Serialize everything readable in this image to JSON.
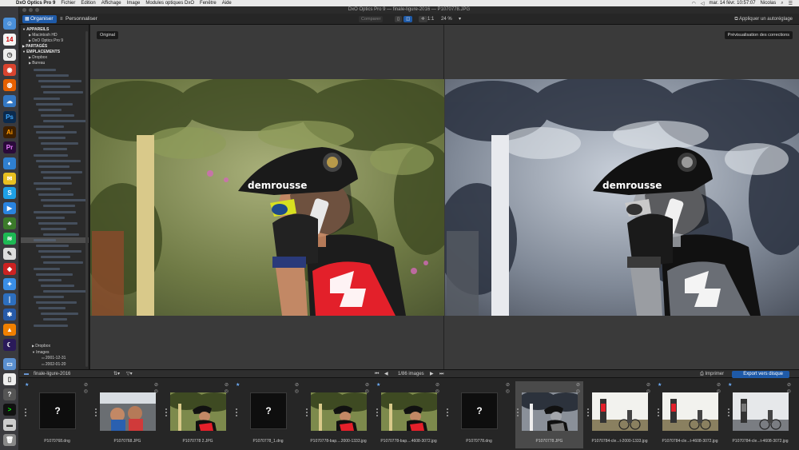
{
  "menubar": {
    "app": "DxO Optics Pro 9",
    "items": [
      "Fichier",
      "Edition",
      "Affichage",
      "Image",
      "Modules optiques DxO",
      "Fenêtre",
      "Aide"
    ],
    "clock": "mar. 14 févr. 10:57:07",
    "user": "Nicolas"
  },
  "window": {
    "app_title": "DxO Optics Pro 9",
    "title": "DxO Optics Pro 9 — finale-ligure-2016 — P1070778.JPG"
  },
  "toolbar": {
    "tab_organize": "Organiser",
    "tab_customize": "Personnaliser",
    "compare_label": "Comparer",
    "zoom_one": "1:1",
    "zoom_pct": "24 %",
    "apply_preset": "Appliquer un autoréglage"
  },
  "sidebar": {
    "rows": [
      {
        "text": "APPAREILS",
        "head": true,
        "indent": 2,
        "arrow": "▼"
      },
      {
        "text": "Macintosh HD",
        "indent": 10,
        "arrow": "▶"
      },
      {
        "text": "DxO Optics Pro 9",
        "indent": 10,
        "arrow": "▶"
      },
      {
        "text": "PARTAGÉS",
        "head": true,
        "indent": 2,
        "arrow": "▶"
      },
      {
        "text": "EMPLACEMENTS",
        "head": true,
        "indent": 2,
        "arrow": "▼"
      },
      {
        "text": "Dropbox",
        "indent": 10,
        "arrow": "▶"
      },
      {
        "text": "Bureau",
        "indent": 10,
        "arrow": "▶"
      }
    ],
    "bottom_rows": [
      {
        "text": "Dropbox",
        "indent": 14,
        "arrow": "▶"
      },
      {
        "text": "Images",
        "indent": 14,
        "arrow": "▼"
      },
      {
        "text": "2001-12-31",
        "indent": 26,
        "arrow": ""
      },
      {
        "text": "2002-01-20",
        "indent": 26,
        "arrow": ""
      }
    ]
  },
  "viewer": {
    "left_badge": "Original",
    "right_badge": "Prévisualisation des corrections",
    "helmet_brand": "demrousse"
  },
  "filmstrip": {
    "folder": "finale-ligure-2016",
    "count": "1/86 images",
    "print": "Imprimer",
    "export": "Export vers disque",
    "thumbs": [
      {
        "cap": "P1070768.dng",
        "kind": "missing",
        "star": true,
        "sel": false
      },
      {
        "cap": "P1070768.JPG",
        "kind": "selfie",
        "star": false,
        "sel": false
      },
      {
        "cap": "P1070778 2.JPG",
        "kind": "rider",
        "star": false,
        "sel": false
      },
      {
        "cap": "P1070778_1.dng",
        "kind": "missing",
        "star": true,
        "sel": false
      },
      {
        "cap": "P1070778-bap....2000-1333.jpg",
        "kind": "rider",
        "star": false,
        "sel": false
      },
      {
        "cap": "P1070778-bap....4608-3072.jpg",
        "kind": "rider",
        "star": true,
        "sel": false
      },
      {
        "cap": "P1070778.dng",
        "kind": "missing",
        "star": false,
        "sel": false
      },
      {
        "cap": "P1070778.JPG",
        "kind": "rider-bw",
        "star": false,
        "sel": true
      },
      {
        "cap": "P1070784-cle...t-2000-1333.jpg",
        "kind": "two",
        "star": false,
        "sel": false
      },
      {
        "cap": "P1070784-cle...t-4608-3072.jpg",
        "kind": "two",
        "star": true,
        "sel": false
      },
      {
        "cap": "P1070784-cle...t-4608-3072.jpg",
        "kind": "two-bw",
        "star": true,
        "sel": false
      }
    ]
  },
  "colors": {
    "accent": "#1e5aa8",
    "jersey_red": "#e3202a",
    "bg_panel": "#3a3a3a"
  }
}
